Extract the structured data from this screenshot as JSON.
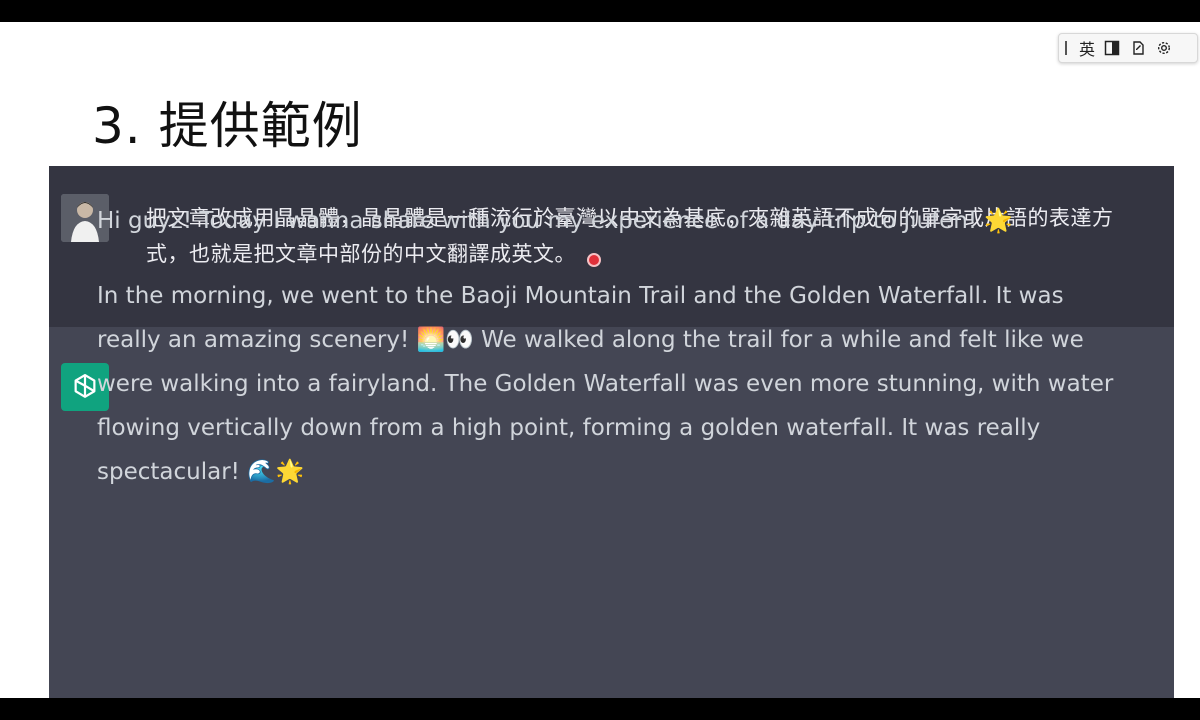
{
  "ime_toolbar": {
    "language_label": "英",
    "icons": [
      "input-mode-icon",
      "half-full-width-icon",
      "tools-icon",
      "gear-icon"
    ]
  },
  "slide": {
    "title": "3. 提供範例"
  },
  "chat": {
    "user_message": "把文章改成用晶晶體，晶晶體是一種流行於臺灣以中文為基底，夾雜英語不成句的單字或片語的表達方式，也就是把文章中部份的中文翻譯成英文。",
    "assistant_paragraphs": [
      "Hi guyz! Today I wanna share with you my experience of a day trip to Jiufen! 🌟",
      "In the morning, we went to the Baoji Mountain Trail and the Golden Waterfall. It was really an amazing scenery! 🌅👀 We walked along the trail for a while and felt like we were walking into a fairyland. The Golden Waterfall was even more stunning, with water flowing vertically down from a high point, forming a golden waterfall. It was really spectacular! 🌊🌟"
    ]
  },
  "colors": {
    "user_bg": "#343541",
    "assistant_bg": "#444654",
    "assistant_avatar": "#10a37f",
    "text": "#d1d5db"
  }
}
